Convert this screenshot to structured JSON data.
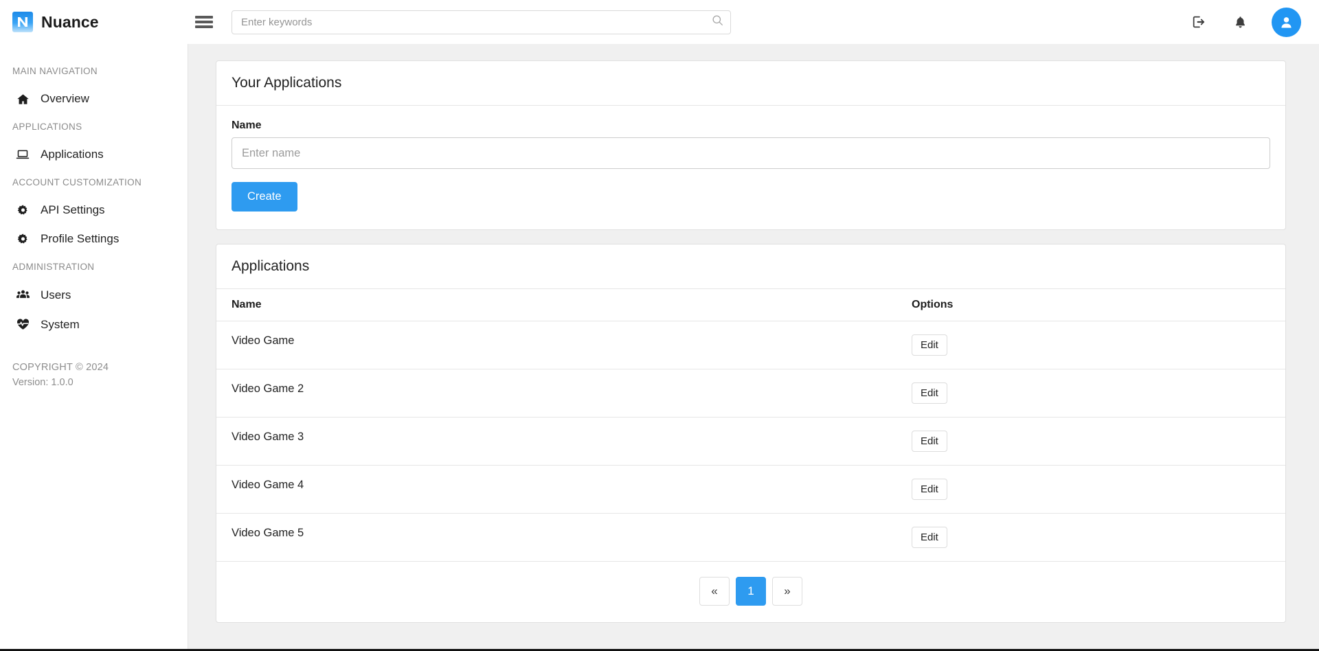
{
  "header": {
    "brand": "Nuance",
    "logo_icon": "letter-n-logo",
    "menu_toggle_icon": "hamburger-icon",
    "search": {
      "placeholder": "Enter keywords",
      "value": "",
      "icon": "search-icon"
    },
    "actions": [
      {
        "name": "logout-icon",
        "title": "Logout"
      },
      {
        "name": "bell-icon",
        "title": "Notifications"
      },
      {
        "name": "user-avatar-icon",
        "title": "Account"
      }
    ],
    "accent_color": "#2e9bf0"
  },
  "sidebar": {
    "groups": [
      {
        "heading": "MAIN NAVIGATION",
        "items": [
          {
            "label": "Overview",
            "icon": "home-icon"
          }
        ]
      },
      {
        "heading": "APPLICATIONS",
        "items": [
          {
            "label": "Applications",
            "icon": "laptop-icon"
          }
        ]
      },
      {
        "heading": "ACCOUNT CUSTOMIZATION",
        "items": [
          {
            "label": "API Settings",
            "icon": "gear-icon"
          },
          {
            "label": "Profile Settings",
            "icon": "gear-icon"
          }
        ]
      },
      {
        "heading": "ADMINISTRATION",
        "items": [
          {
            "label": "Users",
            "icon": "users-icon"
          },
          {
            "label": "System",
            "icon": "heartbeat-icon"
          }
        ]
      }
    ],
    "footer": {
      "copyright": "COPYRIGHT © 2024",
      "version": "Version: 1.0.0"
    }
  },
  "main": {
    "create_card": {
      "title": "Your Applications",
      "name_label": "Name",
      "name_placeholder": "Enter name",
      "name_value": "",
      "create_button": "Create"
    },
    "list_card": {
      "title": "Applications",
      "columns": [
        "Name",
        "Options"
      ],
      "edit_label": "Edit",
      "rows": [
        {
          "name": "Video Game",
          "option": "Edit"
        },
        {
          "name": "Video Game 2",
          "option": "Edit"
        },
        {
          "name": "Video Game 3",
          "option": "Edit"
        },
        {
          "name": "Video Game 4",
          "option": "Edit"
        },
        {
          "name": "Video Game 5",
          "option": "Edit"
        }
      ],
      "pagination": {
        "prev": "«",
        "next": "»",
        "pages": [
          "1"
        ],
        "active_page": "1"
      }
    }
  }
}
